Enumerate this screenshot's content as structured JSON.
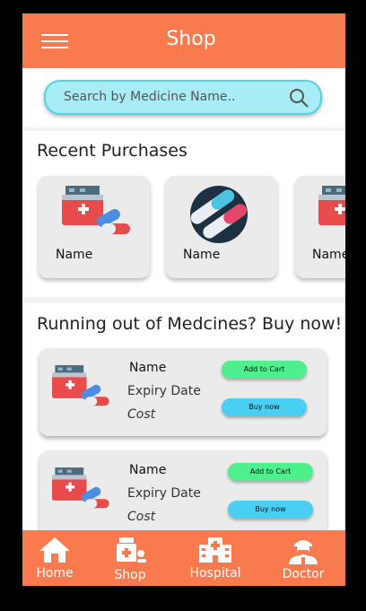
{
  "header": {
    "title": "Shop",
    "menu_icon": "hamburger-menu-icon"
  },
  "search": {
    "placeholder": "Search by Medicine Name..",
    "icon": "search-icon",
    "accent": "#4fd3e6"
  },
  "recent": {
    "title": "Recent Purchases",
    "items": [
      {
        "label": "Name",
        "icon": "medicine-kit-icon"
      },
      {
        "label": "Name",
        "icon": "capsule-icon"
      },
      {
        "label": "Name",
        "icon": "medicine-kit-icon"
      }
    ]
  },
  "running_out": {
    "title": "Running out of Medcines? Buy now!",
    "items": [
      {
        "name": "Name",
        "expiry": "Expiry Date",
        "cost": "Cost",
        "add_label": "Add to Cart",
        "buy_label": "Buy now"
      },
      {
        "name": "Name",
        "expiry": "Expiry Date",
        "cost": "Cost",
        "add_label": "Add to Cart",
        "buy_label": "Buy now"
      }
    ]
  },
  "nav": {
    "items": [
      {
        "label": "Home",
        "icon": "home-icon"
      },
      {
        "label": "Shop",
        "icon": "shop-icon"
      },
      {
        "label": "Hospital",
        "icon": "hospital-icon"
      },
      {
        "label": "Doctor",
        "icon": "doctor-icon"
      }
    ]
  },
  "colors": {
    "brand": "#fa7a4f",
    "add_button": "#4ef08e",
    "buy_button": "#49cff2"
  }
}
